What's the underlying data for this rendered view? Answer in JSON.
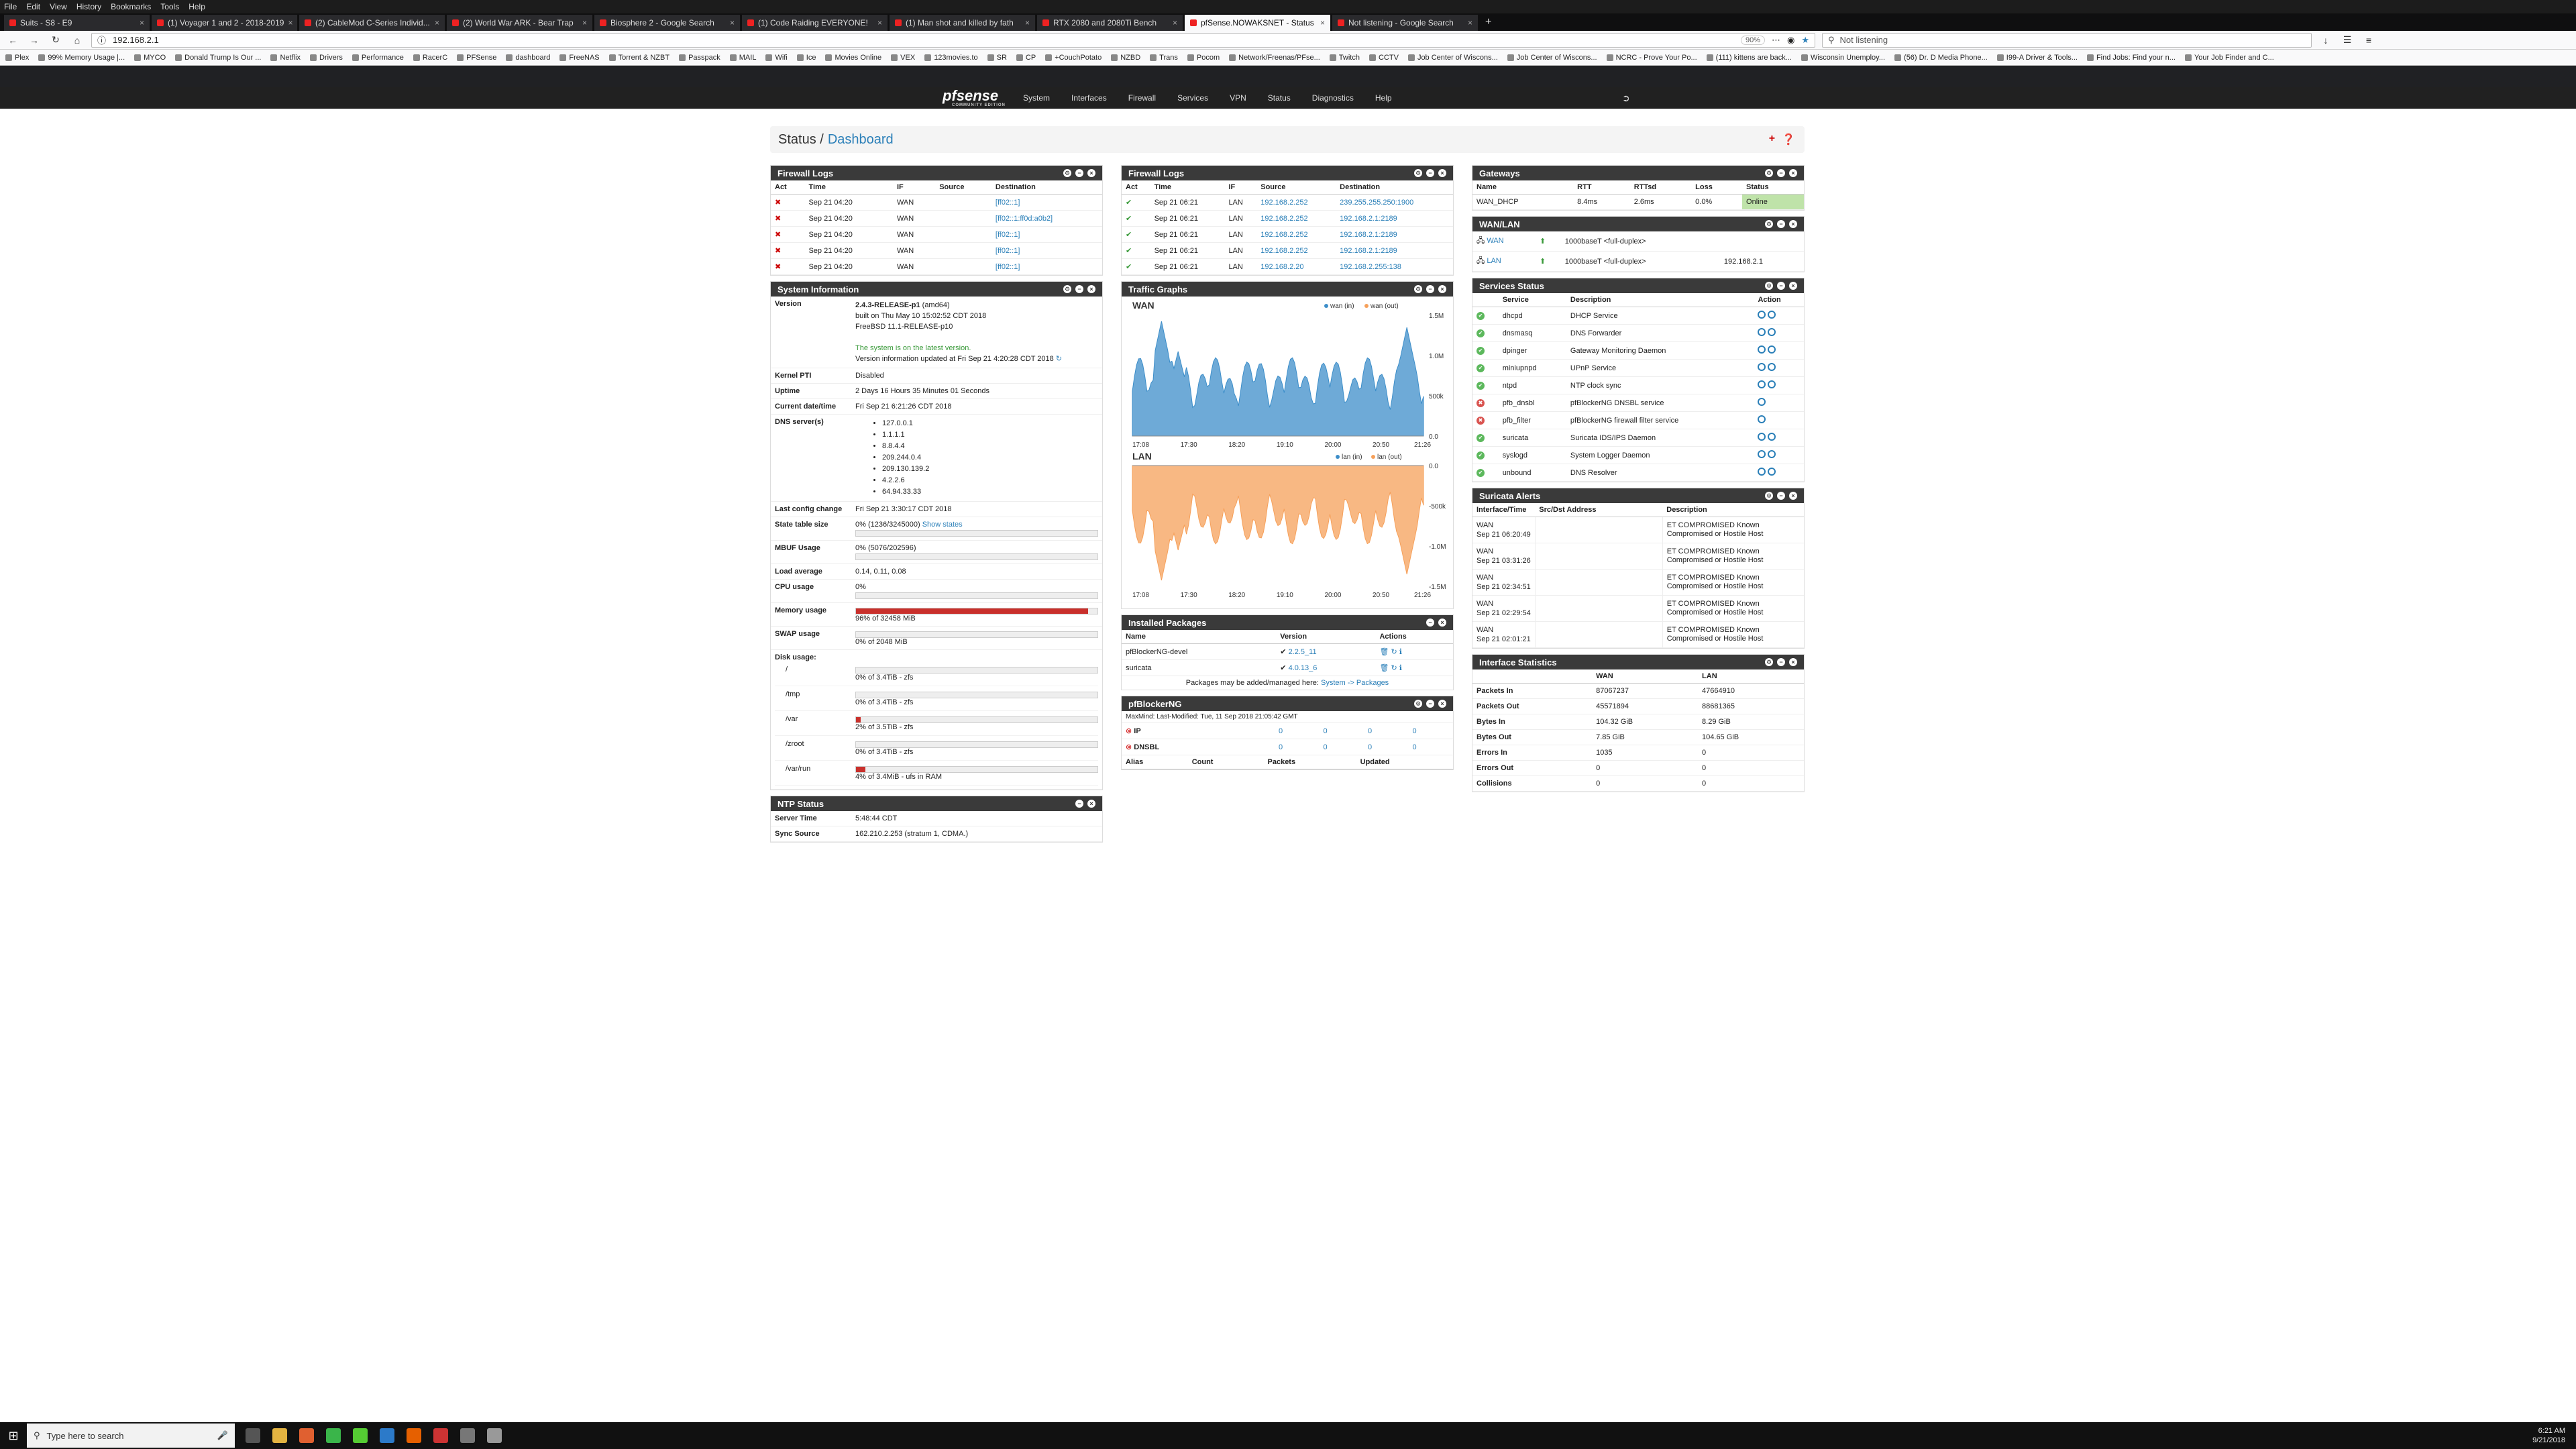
{
  "browser": {
    "menu": [
      "File",
      "Edit",
      "View",
      "History",
      "Bookmarks",
      "Tools",
      "Help"
    ],
    "tabs": [
      "Suits - S8 - E9",
      "(1) Voyager 1 and 2 - 2018-2019",
      "(2) CableMod C-Series Individ...",
      "(2) World War ARK - Bear Trap",
      "Biosphere 2 - Google Search",
      "(1) Code Raiding EVERYONE!",
      "(1) Man shot and killed by fath",
      "RTX 2080 and 2080Ti Bench",
      "pfSense.NOWAKSNET - Status",
      "Not listening - Google Search"
    ],
    "url": "192.168.2.1",
    "zoom": "90%",
    "search_value": "Not listening",
    "bookmarks": [
      "Plex",
      "99% Memory Usage |...",
      "MYCO",
      "Donald Trump Is Our ...",
      "Netflix",
      "Drivers",
      "Performance",
      "RacerC",
      "PFSense",
      "dashboard",
      "FreeNAS",
      "Torrent & NZBT",
      "Passpack",
      "MAIL",
      "Wifi",
      "Ice",
      "Movies Online",
      "VEX",
      "123movies.to",
      "SR",
      "CP",
      "+CouchPotato",
      "NZBD",
      "Trans",
      "Pocom",
      "Network/Freenas/PFse...",
      "Twitch",
      "CCTV",
      "Job Center of Wiscons...",
      "Job Center of Wiscons...",
      "NCRC - Prove Your Po...",
      "(111) kittens are back...",
      "Wisconsin Unemploy...",
      "(56) Dr. D Media Phone...",
      "I99-A Driver & Tools...",
      "Find Jobs: Find your n...",
      "Your Job Finder and C..."
    ]
  },
  "pfsense": {
    "logo": "pfsense",
    "logo_sub": "COMMUNITY EDITION",
    "menu": [
      "System",
      "Interfaces",
      "Firewall",
      "Services",
      "VPN",
      "Status",
      "Diagnostics",
      "Help"
    ],
    "crumb_status": "Status /",
    "crumb_page": "Dashboard"
  },
  "fw1": {
    "title": "Firewall Logs",
    "cols": [
      "Act",
      "Time",
      "IF",
      "Source",
      "Destination"
    ],
    "rows": [
      {
        "time": "Sep 21 04:20",
        "if": "WAN",
        "src": "",
        "dst": "[ff02::1]"
      },
      {
        "time": "Sep 21 04:20",
        "if": "WAN",
        "src": "",
        "dst": "[ff02::1:ff0d:a0b2]"
      },
      {
        "time": "Sep 21 04:20",
        "if": "WAN",
        "src": "",
        "dst": "[ff02::1]"
      },
      {
        "time": "Sep 21 04:20",
        "if": "WAN",
        "src": "",
        "dst": "[ff02::1]"
      },
      {
        "time": "Sep 21 04:20",
        "if": "WAN",
        "src": "",
        "dst": "[ff02::1]"
      }
    ]
  },
  "fw2": {
    "title": "Firewall Logs",
    "cols": [
      "Act",
      "Time",
      "IF",
      "Source",
      "Destination"
    ],
    "rows": [
      {
        "time": "Sep 21 06:21",
        "if": "LAN",
        "src": "192.168.2.252",
        "dst": "239.255.255.250:1900"
      },
      {
        "time": "Sep 21 06:21",
        "if": "LAN",
        "src": "192.168.2.252",
        "dst": "192.168.2.1:2189"
      },
      {
        "time": "Sep 21 06:21",
        "if": "LAN",
        "src": "192.168.2.252",
        "dst": "192.168.2.1:2189"
      },
      {
        "time": "Sep 21 06:21",
        "if": "LAN",
        "src": "192.168.2.252",
        "dst": "192.168.2.1:2189"
      },
      {
        "time": "Sep 21 06:21",
        "if": "LAN",
        "src": "192.168.2.20",
        "dst": "192.168.2.255:138"
      }
    ]
  },
  "sysinfo": {
    "title": "System Information",
    "version_label": "Version",
    "version": "2.4.3-RELEASE-p1",
    "arch": "(amd64)",
    "built": "built on Thu May 10 15:02:52 CDT 2018",
    "freebsd": "FreeBSD 11.1-RELEASE-p10",
    "latest": "The system is on the latest version.",
    "updated": "Version information updated at Fri Sep 21 4:20:28 CDT 2018",
    "kpti_label": "Kernel PTI",
    "kpti": "Disabled",
    "uptime_label": "Uptime",
    "uptime": "2 Days 16 Hours 35 Minutes 01 Seconds",
    "datetime_label": "Current date/time",
    "datetime": "Fri Sep 21 6:21:26 CDT 2018",
    "dns_label": "DNS server(s)",
    "dns": [
      "127.0.0.1",
      "1.1.1.1",
      "8.8.4.4",
      "209.244.0.4",
      "209.130.139.2",
      "4.2.2.6",
      "64.94.33.33"
    ],
    "lastcfg_label": "Last config change",
    "lastcfg": "Fri Sep 21 3:30:17 CDT 2018",
    "state_label": "State table size",
    "state": "0% (1236/3245000)",
    "state_link": "Show states",
    "mbuf_label": "MBUF Usage",
    "mbuf": "0% (5076/202596)",
    "load_label": "Load average",
    "load": "0.14, 0.11, 0.08",
    "cpu_label": "CPU usage",
    "cpu": "0%",
    "mem_label": "Memory usage",
    "mem": "96% of 32458 MiB",
    "mem_pct": 96,
    "swap_label": "SWAP usage",
    "swap": "0% of 2048 MiB",
    "disk_label": "Disk usage:",
    "disks": [
      {
        "mount": "/",
        "usage": "0% of 3.4TiB - zfs",
        "pct": 0
      },
      {
        "mount": "/tmp",
        "usage": "0% of 3.4TiB - zfs",
        "pct": 0
      },
      {
        "mount": "/var",
        "usage": "2% of 3.5TiB - zfs",
        "pct": 2
      },
      {
        "mount": "/zroot",
        "usage": "0% of 3.4TiB - zfs",
        "pct": 0
      },
      {
        "mount": "/var/run",
        "usage": "4% of 3.4MiB - ufs in RAM",
        "pct": 4
      }
    ]
  },
  "ntp": {
    "title": "NTP Status",
    "time_label": "Server Time",
    "time": "5:48:44 CDT",
    "sync_label": "Sync Source",
    "sync": "162.210.2.253 (stratum 1, CDMA.)"
  },
  "traffic": {
    "title": "Traffic Graphs",
    "wan_title": "WAN",
    "lan_title": "LAN",
    "wan_legend": [
      "wan (in)",
      "wan (out)"
    ],
    "lan_legend": [
      "lan (in)",
      "lan (out)"
    ],
    "x_ticks": [
      "17:08",
      "17:30",
      "18:20",
      "19:10",
      "20:00",
      "20:50",
      "21:26"
    ],
    "wan_y": [
      "1.5M",
      "1.0M",
      "500k",
      "0.0"
    ],
    "lan_y": [
      "0.0",
      "-500k",
      "-1.0M",
      "-1.5M"
    ],
    "wan_color": "#3d8ec9",
    "lan_color": "#f6a05a"
  },
  "packages": {
    "title": "Installed Packages",
    "cols": [
      "Name",
      "Version",
      "Actions"
    ],
    "rows": [
      {
        "name": "pfBlockerNG-devel",
        "version": "2.2.5_11"
      },
      {
        "name": "suricata",
        "version": "4.0.13_6"
      }
    ],
    "footer": "Packages may be added/managed here:",
    "footer_link": "System -> Packages"
  },
  "pfb": {
    "title": "pfBlockerNG",
    "maxmind": "MaxMind: Last-Modified: Tue, 11 Sep 2018 21:05:42 GMT",
    "rows": [
      {
        "label": "IP",
        "c1": "0",
        "c2": "0",
        "c3": "0",
        "c4": "0"
      },
      {
        "label": "DNSBL",
        "c1": "0",
        "c2": "0",
        "c3": "0",
        "c4": "0"
      }
    ],
    "cols": [
      "Alias",
      "Count",
      "Packets",
      "Updated"
    ]
  },
  "gateways": {
    "title": "Gateways",
    "cols": [
      "Name",
      "RTT",
      "RTTsd",
      "Loss",
      "Status"
    ],
    "rows": [
      {
        "name": "WAN_DHCP",
        "rtt": "8.4ms",
        "rttsd": "2.6ms",
        "loss": "0.0%",
        "status": "Online"
      }
    ]
  },
  "wanlan": {
    "title": "WAN/LAN",
    "rows": [
      {
        "name": "WAN",
        "media": "1000baseT <full-duplex>",
        "ip": ""
      },
      {
        "name": "LAN",
        "media": "1000baseT <full-duplex>",
        "ip": "192.168.2.1"
      }
    ]
  },
  "services": {
    "title": "Services Status",
    "cols": [
      "Service",
      "Description",
      "Action"
    ],
    "rows": [
      {
        "name": "dhcpd",
        "desc": "DHCP Service",
        "ok": true
      },
      {
        "name": "dnsmasq",
        "desc": "DNS Forwarder",
        "ok": true
      },
      {
        "name": "dpinger",
        "desc": "Gateway Monitoring Daemon",
        "ok": true
      },
      {
        "name": "miniupnpd",
        "desc": "UPnP Service",
        "ok": true
      },
      {
        "name": "ntpd",
        "desc": "NTP clock sync",
        "ok": true
      },
      {
        "name": "pfb_dnsbl",
        "desc": "pfBlockerNG DNSBL service",
        "ok": false
      },
      {
        "name": "pfb_filter",
        "desc": "pfBlockerNG firewall filter service",
        "ok": false
      },
      {
        "name": "suricata",
        "desc": "Suricata IDS/IPS Daemon",
        "ok": true
      },
      {
        "name": "syslogd",
        "desc": "System Logger Daemon",
        "ok": true
      },
      {
        "name": "unbound",
        "desc": "DNS Resolver",
        "ok": true
      }
    ]
  },
  "suricata": {
    "title": "Suricata Alerts",
    "cols": [
      "Interface/Time",
      "Src/Dst Address",
      "Description"
    ],
    "rows": [
      {
        "if": "WAN",
        "time": "Sep 21 06:20:49",
        "desc": "ET COMPROMISED Known Compromised or Hostile Host"
      },
      {
        "if": "WAN",
        "time": "Sep 21 03:31:26",
        "desc": "ET COMPROMISED Known Compromised or Hostile Host"
      },
      {
        "if": "WAN",
        "time": "Sep 21 02:34:51",
        "desc": "ET COMPROMISED Known Compromised or Hostile Host"
      },
      {
        "if": "WAN",
        "time": "Sep 21 02:29:54",
        "desc": "ET COMPROMISED Known Compromised or Hostile Host"
      },
      {
        "if": "WAN",
        "time": "Sep 21 02:01:21",
        "desc": "ET COMPROMISED Known Compromised or Hostile Host"
      }
    ]
  },
  "ifstats": {
    "title": "Interface Statistics",
    "cols": [
      "",
      "WAN",
      "LAN"
    ],
    "rows": [
      {
        "k": "Packets In",
        "wan": "87067237",
        "lan": "47664910"
      },
      {
        "k": "Packets Out",
        "wan": "45571894",
        "lan": "88681365"
      },
      {
        "k": "Bytes In",
        "wan": "104.32 GiB",
        "lan": "8.29 GiB"
      },
      {
        "k": "Bytes Out",
        "wan": "7.85 GiB",
        "lan": "104.65 GiB"
      },
      {
        "k": "Errors In",
        "wan": "1035",
        "lan": "0"
      },
      {
        "k": "Errors Out",
        "wan": "0",
        "lan": "0"
      },
      {
        "k": "Collisions",
        "wan": "0",
        "lan": "0"
      }
    ]
  },
  "taskbar": {
    "search": "Type here to search",
    "time": "6:21 AM",
    "date": "9/21/2018"
  }
}
